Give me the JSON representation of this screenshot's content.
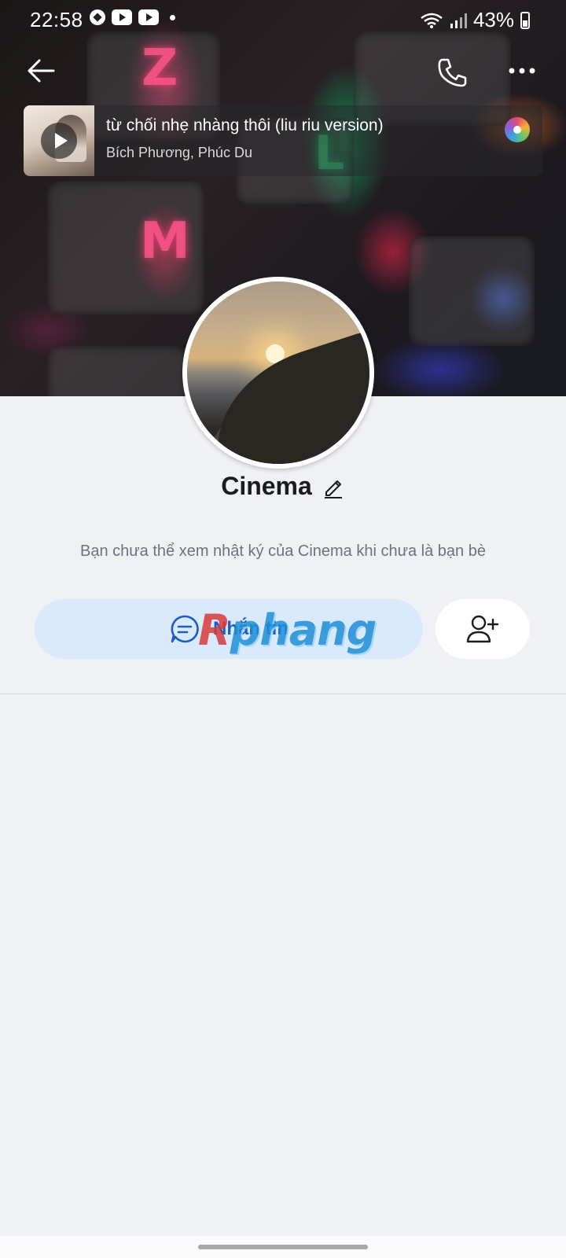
{
  "status_bar": {
    "time": "22:58",
    "battery": "43%",
    "left_icons": [
      "soccer-icon",
      "youtube-icon",
      "youtube-icon",
      "notification-dot"
    ],
    "right_icons": [
      "wifi-icon",
      "signal-icon",
      "battery-icon"
    ]
  },
  "header": {
    "back_icon": "arrow-left-icon",
    "call_icon": "phone-icon",
    "more_icon": "more-horizontal-icon"
  },
  "music": {
    "title": "từ chối nhẹ nhàng thôi (liu riu version)",
    "artist": "Bích Phương, Phúc Du",
    "play_icon": "play-icon",
    "disc_icon": "music-disc-icon"
  },
  "profile": {
    "name": "Cinema",
    "edit_icon": "pencil-icon",
    "privacy_note": "Bạn chưa thể xem nhật ký của Cinema khi chưa là bạn bè"
  },
  "actions": {
    "message_label": "Nhắn tin",
    "message_icon": "chat-bubble-icon",
    "add_friend_icon": "add-user-icon"
  },
  "watermark": {
    "text_first": "R",
    "text_rest": "phang"
  },
  "colors": {
    "page_bg": "#eff1f5",
    "message_btn_bg": "#dbe9fd",
    "message_text": "#1a5ec7",
    "name_text": "#1b1c1f",
    "muted_text": "#6c7280"
  }
}
